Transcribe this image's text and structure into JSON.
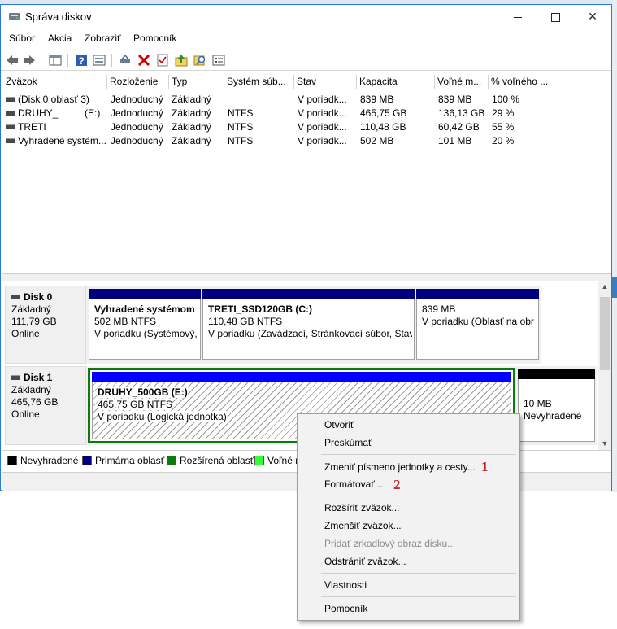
{
  "window": {
    "title": "Správa diskov"
  },
  "menubar": [
    "Súbor",
    "Akcia",
    "Zobraziť",
    "Pomocník"
  ],
  "toolbar": {
    "icons": [
      "back-arrow-icon",
      "forward-arrow-icon",
      "console-tree-icon",
      "help-icon",
      "properties-icon",
      "connect-drive-icon",
      "delete-icon",
      "checklist-icon",
      "import-icon",
      "search-icon",
      "settings-panel-icon"
    ],
    "delete_color": "#d00000"
  },
  "volume_table": {
    "headers": [
      "Zväzok",
      "Rozloženie",
      "Typ",
      "Systém súb...",
      "Stav",
      "Kapacita",
      "Voľné m...",
      "% voľného ..."
    ],
    "rows": [
      {
        "name": "(Disk 0 oblasť 3)",
        "layout": "Jednoduchý",
        "type": "Základný",
        "fs": "",
        "status": "V poriadk...",
        "capacity": "839 MB",
        "free": "839 MB",
        "pct": "100 %"
      },
      {
        "name": "DRUHY_",
        "letter": "(E:)",
        "layout": "Jednoduchý",
        "type": "Základný",
        "fs": "NTFS",
        "status": "V poriadk...",
        "capacity": "465,75 GB",
        "free": "136,13 GB",
        "pct": "29 %"
      },
      {
        "name": "TRETI",
        "layout": "Jednoduchý",
        "type": "Základný",
        "fs": "NTFS",
        "status": "V poriadk...",
        "capacity": "110,48 GB",
        "free": "60,42 GB",
        "pct": "55 %"
      },
      {
        "name": "Vyhradené systém...",
        "layout": "Jednoduchý",
        "type": "Základný",
        "fs": "NTFS",
        "status": "V poriadk...",
        "capacity": "502 MB",
        "free": "101 MB",
        "pct": "20 %"
      }
    ]
  },
  "disks": [
    {
      "name": "Disk 0",
      "type": "Základný",
      "size": "111,79 GB",
      "status": "Online",
      "partitions": [
        {
          "name": "Vyhradené systémom",
          "size": "502 MB NTFS",
          "status": "V poriadku (Systémový,",
          "bar": "#00007f"
        },
        {
          "name": "TRETI_SSD120GB  (C:)",
          "size": "110,48 GB NTFS",
          "status": "V poriadku (Zavádzací, Stránkovací súbor, Stav",
          "bar": "#00007f"
        },
        {
          "name": "",
          "size": "839 MB",
          "status": "V poriadku (Oblasť na obr",
          "bar": "#00007f"
        }
      ]
    },
    {
      "name": "Disk 1",
      "type": "Základný",
      "size": "465,76 GB",
      "status": "Online",
      "partitions": [
        {
          "name": "DRUHY_500GB  (E:)",
          "size": "465,75 GB NTFS",
          "status": "V poriadku (Logická jednotka)",
          "bar": "#0000ff"
        },
        {
          "name": "",
          "size": "10 MB",
          "status": "Nevyhradené",
          "bar": "#000000"
        }
      ]
    }
  ],
  "legend": [
    {
      "label": "Nevyhradené",
      "color": "#000000"
    },
    {
      "label": "Primárna oblasť",
      "color": "#00007f"
    },
    {
      "label": "Rozšírená oblasť",
      "color": "#0e7a0e"
    },
    {
      "label": "Voľné m",
      "color": "#33ff33"
    }
  ],
  "context_menu": {
    "items": [
      {
        "label": "Otvoriť"
      },
      {
        "label": "Preskúmať"
      },
      {
        "label": "Zmeniť písmeno jednotky a cesty..."
      },
      {
        "label": "Formátovať..."
      },
      {
        "label": "Rozšíriť zväzok..."
      },
      {
        "label": "Zmenšiť zväzok..."
      },
      {
        "label": "Pridať zrkadlový obraz disku..."
      },
      {
        "label": "Odstrániť zväzok..."
      },
      {
        "label": "Vlastnosti"
      },
      {
        "label": "Pomocník"
      }
    ],
    "annotations": [
      "1",
      "2"
    ]
  }
}
